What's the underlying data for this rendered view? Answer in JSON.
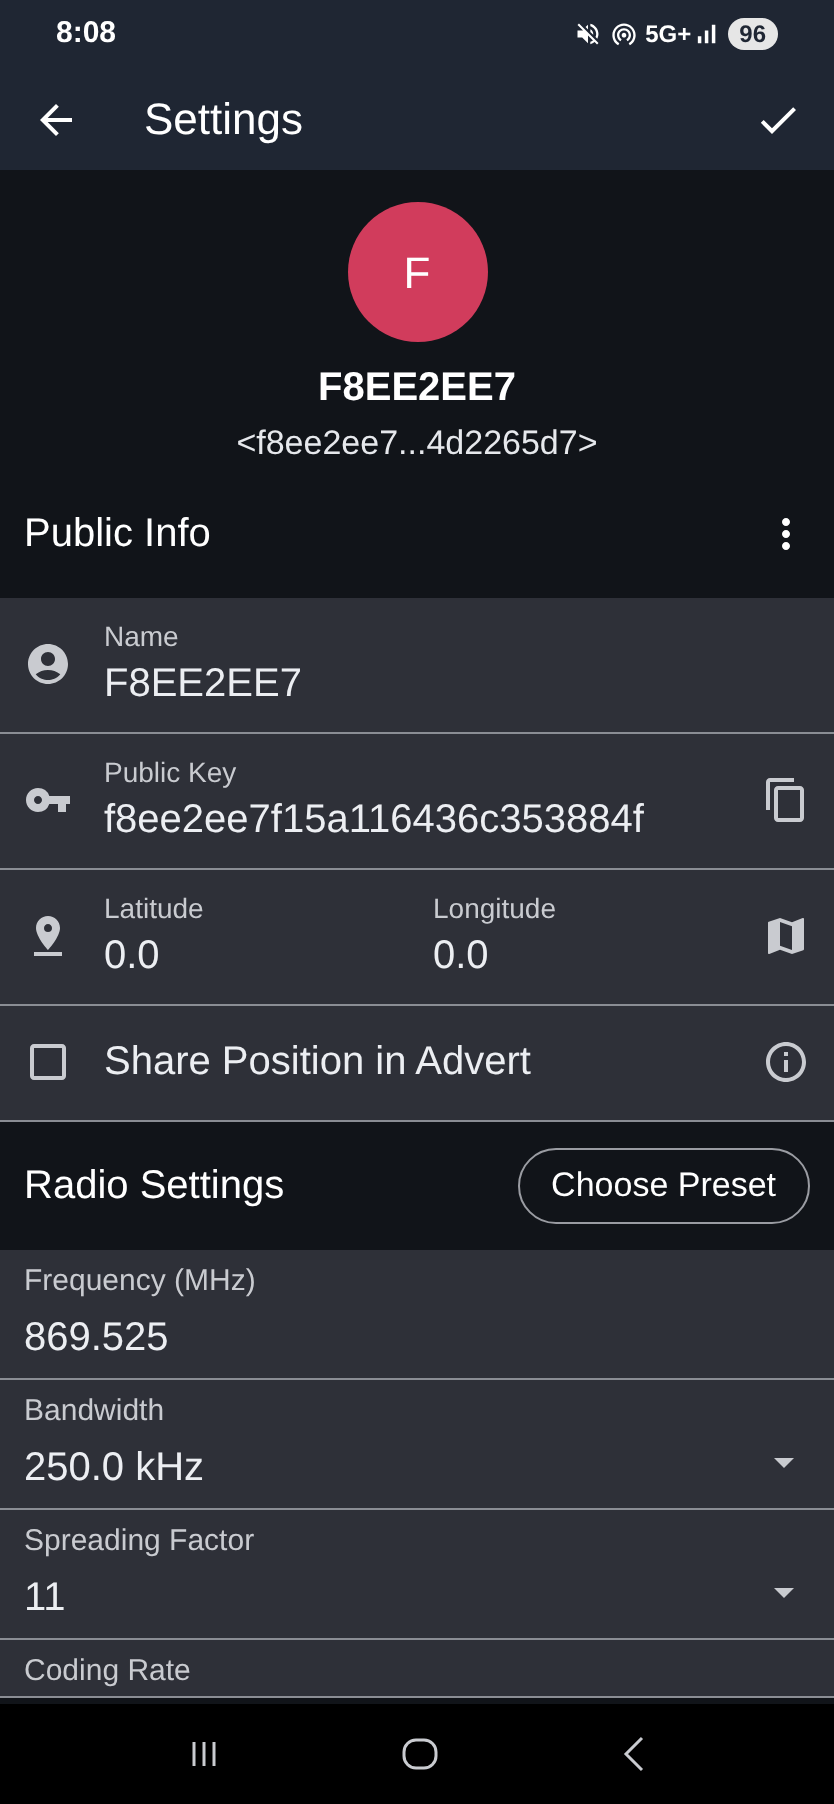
{
  "status_bar": {
    "time": "8:08",
    "network": "5G+",
    "battery": "96"
  },
  "app_bar": {
    "title": "Settings"
  },
  "profile": {
    "initial": "F",
    "name": "F8EE2EE7",
    "key": "<f8ee2ee7...4d2265d7>"
  },
  "public_info": {
    "title": "Public Info",
    "rows": [
      {
        "kind": "field",
        "label": "Name",
        "value": "F8EE2EE7"
      },
      {
        "kind": "key",
        "label": "Public Key",
        "value": "f8ee2ee7f15a116436c353884f"
      },
      {
        "kind": "location",
        "fields": [
          {
            "label": "Latitude",
            "value": "0.0"
          },
          {
            "label": "Longitude",
            "value": "0.0"
          }
        ]
      },
      {
        "kind": "checkbox",
        "label": "Share Position in Advert",
        "checked": false
      }
    ]
  },
  "radio_settings": {
    "title": "Radio Settings",
    "preset_button": "Choose Preset",
    "fields": [
      {
        "kind": "text",
        "label": "Frequency (MHz)",
        "value": "869.525"
      },
      {
        "kind": "dropdown",
        "label": "Bandwidth",
        "value": "250.0 kHz"
      },
      {
        "kind": "dropdown",
        "label": "Spreading Factor",
        "value": "11"
      },
      {
        "kind": "text",
        "label": "Coding Rate"
      }
    ]
  }
}
